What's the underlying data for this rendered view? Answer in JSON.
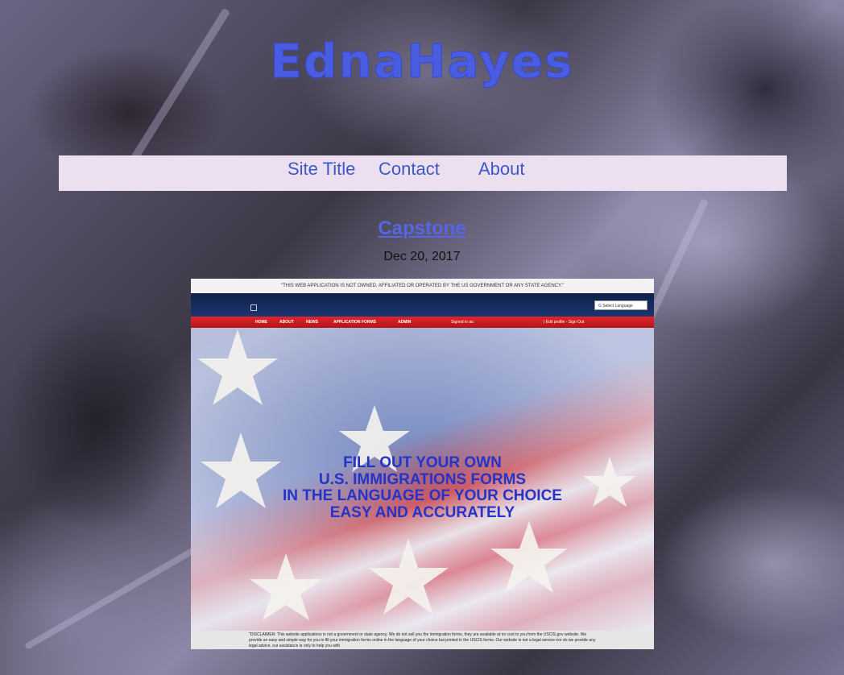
{
  "site": {
    "logo": "EdnaHayes"
  },
  "nav": {
    "items": [
      "Site Title",
      "Contact",
      "About"
    ]
  },
  "post": {
    "title": "Capstone",
    "date": "Dec 20, 2017"
  },
  "screenshot": {
    "top_notice": "\"THIS WEB APPLICATION IS NOT OWNED, AFFILIATED OR OPERATED BY THE US GOVERNMENT OR ANY STATE AGENCY.\"",
    "language_select": "Select Language",
    "nav_items": [
      "HOME",
      "ABOUT",
      "NEWS",
      "APPLICATION FORMS",
      "ADMIN"
    ],
    "signed_in": "Signed in as:",
    "account_links": "| Edit profile - Sign Out",
    "hero_lines": [
      "FILL OUT YOUR OWN",
      "U.S. IMMIGRATIONS FORMS",
      "IN THE LANGUAGE OF YOUR CHOICE",
      "EASY AND ACCURATELY"
    ],
    "disclaimer": "\"DISCLAIMER: This website applications is not a government or state agency. We do not sell you the Immigration forms, they are available at no cost to you from the USCIS.gov website. We provide an easy and simple way for you to fill your immigration forms online in the language of your choice but printed in the USCIS forms. Our website is not a legal service nor do we provide any legal advice, our assistance is only to help you with"
  },
  "colors": {
    "accent": "#4a5de0",
    "nav_bg": "#ecdff0",
    "link": "#3e58c8"
  }
}
